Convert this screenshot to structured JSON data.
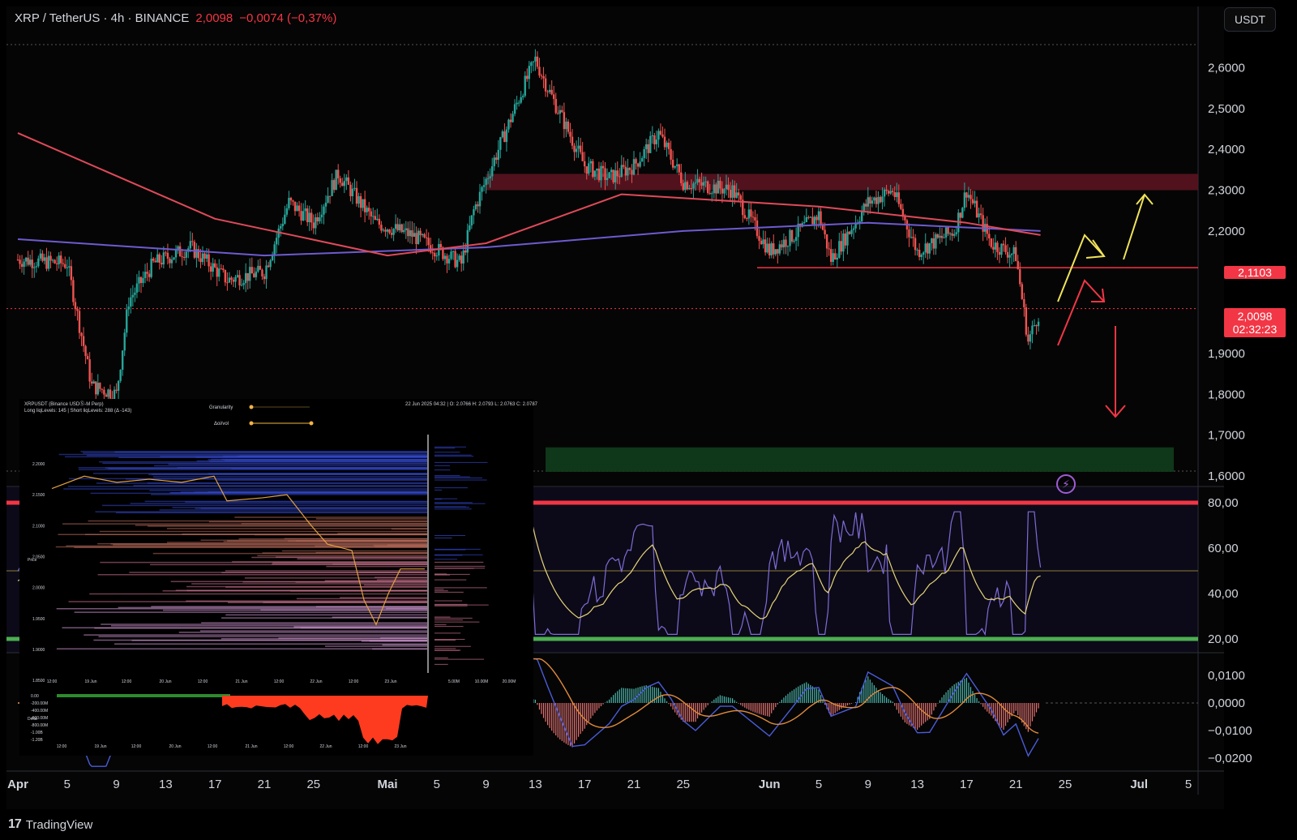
{
  "header": {
    "symbol": "XRP / TetherUS · 4h · BINANCE",
    "price": "2,0098",
    "change": "−0,0074 (−0,37%)"
  },
  "currency_button": "USDT",
  "footer": {
    "logo_mark": "17",
    "brand": "TradingView"
  },
  "last_price_tag": {
    "price": "2,0098",
    "countdown": "02:32:23"
  },
  "level_tag": "2,1103",
  "colors": {
    "up": "#26a69a",
    "down": "#ef5350",
    "resistance": "#5a1420",
    "support": "#113d1c",
    "ma_fast": "#e04a5a",
    "ma_slow": "#6d5bd0",
    "rsi": "#7e6cd6",
    "rsi_ma": "#e6d47a"
  },
  "chart_data": [
    {
      "type": "candlestick",
      "title": "XRP / TetherUS · 4h · BINANCE",
      "y_ticks": [
        "2,6000",
        "2,5000",
        "2,4000",
        "2,3000",
        "2,2000",
        "2,1000",
        "1,9000",
        "1,8000",
        "1,7000",
        "1,6000"
      ],
      "ylim": [
        1.6,
        2.65
      ],
      "x_ticks": [
        "Apr",
        "5",
        "9",
        "13",
        "17",
        "21",
        "25",
        "Mai",
        "5",
        "9",
        "13",
        "17",
        "21",
        "25",
        "Jun",
        "5",
        "9",
        "13",
        "17",
        "21",
        "25",
        "Jul",
        "5"
      ],
      "close_path": [
        {
          "t": "Apr 1",
          "y": 2.13
        },
        {
          "t": "Apr 5",
          "y": 2.12
        },
        {
          "t": "Apr 7",
          "y": 1.82
        },
        {
          "t": "Apr 9",
          "y": 1.8
        },
        {
          "t": "Apr 10",
          "y": 2.03
        },
        {
          "t": "Apr 12",
          "y": 2.12
        },
        {
          "t": "Apr 15",
          "y": 2.16
        },
        {
          "t": "Apr 18",
          "y": 2.08
        },
        {
          "t": "Apr 21",
          "y": 2.1
        },
        {
          "t": "Apr 23",
          "y": 2.27
        },
        {
          "t": "Apr 25",
          "y": 2.22
        },
        {
          "t": "Apr 27",
          "y": 2.34
        },
        {
          "t": "Apr 30",
          "y": 2.22
        },
        {
          "t": "Mai 3",
          "y": 2.19
        },
        {
          "t": "Mai 7",
          "y": 2.12
        },
        {
          "t": "Mai 8",
          "y": 2.25
        },
        {
          "t": "Mai 10",
          "y": 2.4
        },
        {
          "t": "Mai 12",
          "y": 2.55
        },
        {
          "t": "Mai 13",
          "y": 2.62
        },
        {
          "t": "Mai 14",
          "y": 2.55
        },
        {
          "t": "Mai 17",
          "y": 2.36
        },
        {
          "t": "Mai 19",
          "y": 2.33
        },
        {
          "t": "Mai 21",
          "y": 2.36
        },
        {
          "t": "Mai 23",
          "y": 2.44
        },
        {
          "t": "Mai 25",
          "y": 2.32
        },
        {
          "t": "Mai 29",
          "y": 2.3
        },
        {
          "t": "Jun 1",
          "y": 2.15
        },
        {
          "t": "Jun 3",
          "y": 2.19
        },
        {
          "t": "Jun 5",
          "y": 2.24
        },
        {
          "t": "Jun 6",
          "y": 2.13
        },
        {
          "t": "Jun 9",
          "y": 2.27
        },
        {
          "t": "Jun 11",
          "y": 2.3
        },
        {
          "t": "Jun 13",
          "y": 2.15
        },
        {
          "t": "Jun 16",
          "y": 2.2
        },
        {
          "t": "Jun 17",
          "y": 2.3
        },
        {
          "t": "Jun 19",
          "y": 2.17
        },
        {
          "t": "Jun 21",
          "y": 2.14
        },
        {
          "t": "Jun 22",
          "y": 1.93
        },
        {
          "t": "Jun 23",
          "y": 2.01
        }
      ],
      "ma_slow": [
        {
          "t": "Apr 1",
          "y": 2.18
        },
        {
          "t": "Apr 21",
          "y": 2.14
        },
        {
          "t": "Mai 9",
          "y": 2.16
        },
        {
          "t": "Mai 25",
          "y": 2.2
        },
        {
          "t": "Jun 9",
          "y": 2.22
        },
        {
          "t": "Jun 23",
          "y": 2.2
        }
      ],
      "ma_fast": [
        {
          "t": "Apr 1",
          "y": 2.44
        },
        {
          "t": "Apr 17",
          "y": 2.23
        },
        {
          "t": "Mai 1",
          "y": 2.14
        },
        {
          "t": "Mai 9",
          "y": 2.17
        },
        {
          "t": "Mai 20",
          "y": 2.29
        },
        {
          "t": "Jun 5",
          "y": 2.26
        },
        {
          "t": "Jun 17",
          "y": 2.22
        },
        {
          "t": "Jun 23",
          "y": 2.19
        }
      ],
      "zones": [
        {
          "kind": "resistance",
          "from": 2.3,
          "to": 2.34
        },
        {
          "kind": "support",
          "from": 1.61,
          "to": 1.67
        }
      ],
      "level_line": 2.1103
    },
    {
      "type": "line",
      "name": "RSI",
      "y_ticks": [
        "80,00",
        "60,00",
        "40,00",
        "20,00"
      ],
      "ylim": [
        20,
        80
      ],
      "bands": [
        80,
        50,
        20
      ]
    },
    {
      "type": "bar",
      "name": "MACD",
      "y_ticks": [
        "0,0100",
        "0,0000",
        "−0,0100",
        "−0,0200"
      ],
      "ylim": [
        -0.02,
        0.012
      ]
    }
  ],
  "inset": {
    "title_line1": "XRPUSDT (Binance USDⓈ-M Perp)",
    "title_line2": "Long liqLevels: 145 | Short liqLevels: 288 (Δ -143)",
    "ohlc": "22 Jun 2025 04:32 | O: 2.0766 H: 2.0793 L: 2.0763 C: 2.0787",
    "control1": "Granularity",
    "control2": "Δoi/vol",
    "y_ticks": [
      "2.2000",
      "2.1500",
      "2.1000",
      "2.0500",
      "2.0000",
      "1.9500",
      "1.9000",
      "1.8500"
    ],
    "y_axis_label": "Price",
    "x_ticks": [
      "12:00",
      "19 Jun",
      "12:00",
      "20 Jun",
      "12:00",
      "21 Jun",
      "12:00",
      "22 Jun",
      "12:00",
      "23 Jun"
    ],
    "vol_ticks": [
      "5.00M",
      "10.00M",
      "20.00M"
    ],
    "delta_ticks": [
      "0.00",
      "-200.00M",
      "-400.00M",
      "-600.00M",
      "-800.00M",
      "-1.00B",
      "-1.20B"
    ],
    "delta_label": "Delta"
  }
}
